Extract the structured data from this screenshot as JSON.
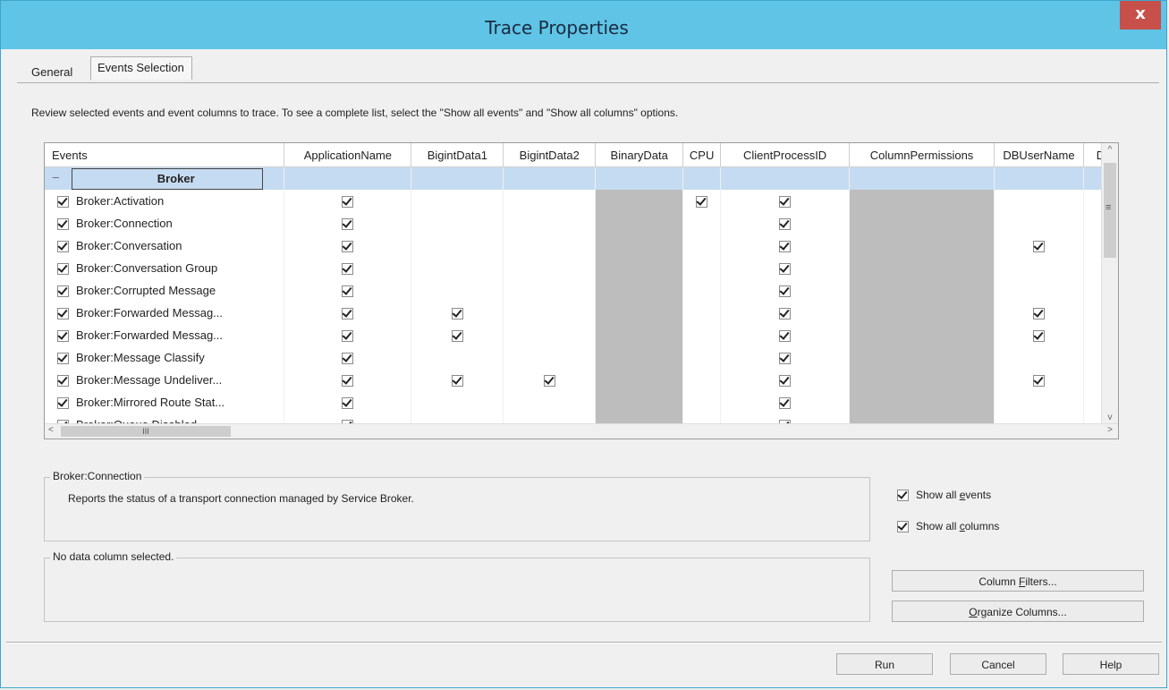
{
  "window": {
    "title": "Trace Properties",
    "close_label": "x"
  },
  "tabs": [
    {
      "label": "General"
    },
    {
      "label": "Events Selection"
    }
  ],
  "description": "Review selected events and event columns to trace. To see a complete list, select the \"Show all events\" and \"Show all columns\" options.",
  "grid": {
    "columns": [
      "Events",
      "ApplicationName",
      "BigintData1",
      "BigintData2",
      "BinaryData",
      "CPU",
      "ClientProcessID",
      "ColumnPermissions",
      "DBUserName",
      "D"
    ],
    "category": {
      "name": "Broker",
      "collapse_glyph": "–"
    },
    "rows": [
      {
        "name": "Broker:Activation",
        "checked": true,
        "cells": [
          true,
          false,
          false,
          "gray",
          true,
          true,
          "gray",
          false
        ]
      },
      {
        "name": "Broker:Connection",
        "checked": true,
        "cells": [
          true,
          false,
          false,
          "gray",
          false,
          true,
          "gray",
          false
        ]
      },
      {
        "name": "Broker:Conversation",
        "checked": true,
        "cells": [
          true,
          false,
          false,
          "gray",
          false,
          true,
          "gray",
          true
        ]
      },
      {
        "name": "Broker:Conversation Group",
        "checked": true,
        "cells": [
          true,
          false,
          false,
          "gray",
          false,
          true,
          "gray",
          false
        ]
      },
      {
        "name": "Broker:Corrupted Message",
        "checked": true,
        "cells": [
          true,
          false,
          false,
          "gray",
          false,
          true,
          "gray",
          false
        ]
      },
      {
        "name": "Broker:Forwarded Messag...",
        "checked": true,
        "cells": [
          true,
          true,
          false,
          "gray",
          false,
          true,
          "gray",
          true
        ]
      },
      {
        "name": "Broker:Forwarded Messag...",
        "checked": true,
        "cells": [
          true,
          true,
          false,
          "gray",
          false,
          true,
          "gray",
          true
        ]
      },
      {
        "name": "Broker:Message Classify",
        "checked": true,
        "cells": [
          true,
          false,
          false,
          "gray",
          false,
          true,
          "gray",
          false
        ]
      },
      {
        "name": "Broker:Message Undeliver...",
        "checked": true,
        "cells": [
          true,
          true,
          true,
          "gray",
          false,
          true,
          "gray",
          true
        ]
      },
      {
        "name": "Broker:Mirrored Route Stat...",
        "checked": true,
        "cells": [
          true,
          false,
          false,
          "gray",
          false,
          true,
          "gray",
          false
        ]
      },
      {
        "name": "Broker:Queue Disabled",
        "checked": true,
        "cells": [
          true,
          false,
          false,
          "gray",
          false,
          true,
          "gray",
          false
        ]
      },
      {
        "name": "",
        "checked": true,
        "cells": [
          false,
          false,
          false,
          "gray",
          false,
          false,
          "gray",
          false
        ]
      }
    ],
    "vscroll": {
      "up": "^",
      "grip": "≡",
      "down": "v"
    },
    "hscroll": {
      "left": "<",
      "grip": "III",
      "right": ">"
    }
  },
  "event_info": {
    "legend": "Broker:Connection",
    "text": "Reports the status of a transport connection managed by Service Broker."
  },
  "column_info": {
    "legend": "No data column selected."
  },
  "options": {
    "show_all_events": {
      "prefix": "Show all ",
      "accel": "e",
      "suffix": "vents",
      "checked": true
    },
    "show_all_columns": {
      "prefix": "Show all ",
      "accel": "c",
      "suffix": "olumns",
      "checked": true
    }
  },
  "buttons": {
    "column_filters": {
      "prefix": "Column ",
      "accel": "F",
      "suffix": "ilters..."
    },
    "organize_columns": {
      "prefix": "",
      "accel": "O",
      "suffix": "rganize Columns..."
    },
    "run": "Run",
    "cancel": "Cancel",
    "help": "Help"
  }
}
